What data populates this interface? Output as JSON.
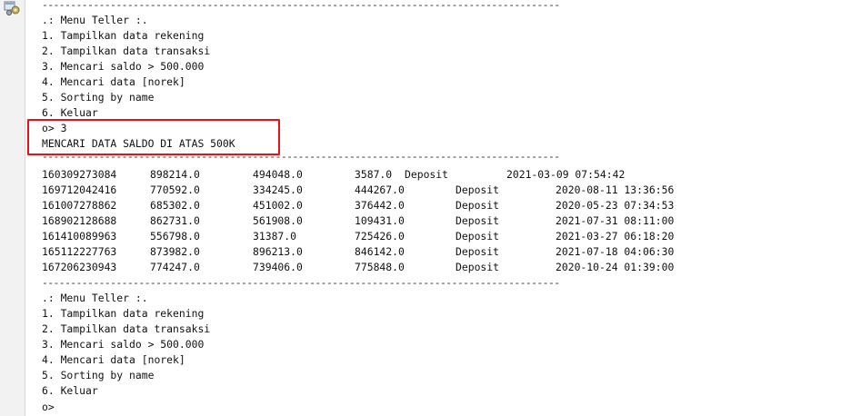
{
  "gutter": {
    "icon": "run-console-icon"
  },
  "console": {
    "separator": "-------------------------------------------------------------------------------------------",
    "menu1": {
      "title": ".: Menu Teller :.",
      "items": [
        "1. Tampilkan data rekening",
        "2. Tampilkan data transaksi",
        "3. Mencari saldo > 500.000",
        "4. Mencari data [norek]",
        "5. Sorting by name",
        "6. Keluar"
      ]
    },
    "prompt_input": "o> 3",
    "result_heading": "MENCARI DATA SALDO DI ATAS 500K",
    "rows": [
      [
        "160309273084",
        "898214.0",
        "494048.0",
        "3587.0",
        "Deposit",
        "2021-03-09 07:54:42"
      ],
      [
        "169712042416",
        "770592.0",
        "334245.0",
        "444267.0",
        "Deposit",
        "2020-08-11 13:36:56"
      ],
      [
        "161007278862",
        "685302.0",
        "451002.0",
        "376442.0",
        "Deposit",
        "2020-05-23 07:34:53"
      ],
      [
        "168902128688",
        "862731.0",
        "561908.0",
        "109431.0",
        "Deposit",
        "2021-07-31 08:11:00"
      ],
      [
        "161410089963",
        "556798.0",
        "31387.0",
        "725426.0",
        "Deposit",
        "2021-03-27 06:18:20"
      ],
      [
        "165112227763",
        "873982.0",
        "896213.0",
        "846142.0",
        "Deposit",
        "2021-07-18 04:06:30"
      ],
      [
        "167206230943",
        "774247.0",
        "739406.0",
        "775848.0",
        "Deposit",
        "2020-10-24 01:39:00"
      ]
    ],
    "menu2": {
      "title": ".: Menu Teller :.",
      "items": [
        "1. Tampilkan data rekening",
        "2. Tampilkan data transaksi",
        "3. Mencari saldo > 500.000",
        "4. Mencari data [norek]",
        "5. Sorting by name",
        "6. Keluar"
      ]
    },
    "prompt_final": "o>"
  },
  "colors": {
    "highlight_border": "#e8111a",
    "text": "#111111",
    "background": "#ffffff"
  }
}
